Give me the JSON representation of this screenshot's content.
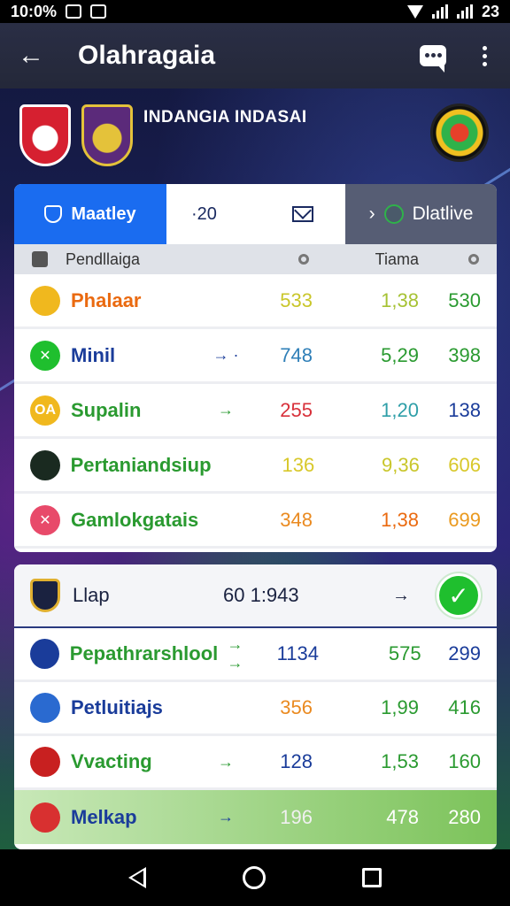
{
  "status_bar": {
    "time": "10:0%",
    "battery": "23"
  },
  "app_bar": {
    "title": "Olahragaia",
    "back_icon": "back-arrow-icon",
    "chat_icon": "chat-icon",
    "menu_icon": "more-vert-icon"
  },
  "league": {
    "name": "INDANGIA INDASAI"
  },
  "tabs": {
    "main": {
      "label": "Maatley",
      "icon": "shield-icon"
    },
    "mid": {
      "label": "·20",
      "icon": "mail-icon"
    },
    "right": {
      "prefix": "›",
      "label": "Dlatlive",
      "icon": "globe-icon"
    }
  },
  "table_header": {
    "team": "Pendllaiga",
    "total": "Tiama"
  },
  "rows": [
    {
      "name": "Phalaar",
      "arrow": "",
      "v1": "533",
      "v2": "1,38",
      "v3": "530",
      "icon_text": "",
      "colors": {
        "icon": "#f0b81e",
        "name": "#ea6a10",
        "v1": "#c9c62a",
        "v2": "#a6c234",
        "v3": "#2a9a30"
      }
    },
    {
      "name": "Minil",
      "arrow": "→ ·",
      "v1": "748",
      "v2": "5,29",
      "v3": "398",
      "icon_text": "✕",
      "colors": {
        "icon": "#1fbf2e",
        "name": "#1a3c9a",
        "v1": "#2f7fb8",
        "v2": "#2a9a30",
        "v3": "#2a9a30"
      }
    },
    {
      "name": "Supalin",
      "arrow": "→",
      "v1": "255",
      "v2": "1,20",
      "v3": "138",
      "icon_text": "OA",
      "colors": {
        "icon": "#f0b81e",
        "name": "#2a9a30",
        "v1": "#d8303a",
        "v2": "#2f9fa8",
        "v3": "#1a3c9a"
      }
    },
    {
      "name": "Pertaniandsiup",
      "arrow": "",
      "v1": "136",
      "v2": "9,36",
      "v3": "606",
      "icon_text": "",
      "colors": {
        "icon": "#1a2a20",
        "name": "#2a9a30",
        "v1": "#d8c82a",
        "v2": "#c9c62a",
        "v3": "#d8c82a"
      }
    },
    {
      "name": "Gamlokgatais",
      "arrow": "",
      "v1": "348",
      "v2": "1,38",
      "v3": "699",
      "icon_text": "✕",
      "colors": {
        "icon": "#e84a6a",
        "name": "#2a9a30",
        "v1": "#ea8a20",
        "v2": "#ea6a10",
        "v3": "#ea9a20"
      }
    }
  ],
  "card2": {
    "header": {
      "name": "Llap",
      "score": "60 1:943",
      "arrow": "→",
      "ok_icon": "check-circle-icon"
    },
    "rows": [
      {
        "name": "Pepathrarshlool",
        "arrow": "→  →",
        "v1": "1134",
        "v2": "575",
        "v3": "299",
        "colors": {
          "icon": "#1a3c9a",
          "name": "#2a9a30",
          "v1": "#1a3c9a",
          "v2": "#2a9a30",
          "v3": "#1a3c9a"
        }
      },
      {
        "name": "Petluitiajs",
        "arrow": "",
        "v1": "356",
        "v2": "1,99",
        "v3": "416",
        "colors": {
          "icon": "#2a6ad0",
          "name": "#1a3c9a",
          "v1": "#ea8a20",
          "v2": "#2a9a30",
          "v3": "#2a9a30"
        }
      },
      {
        "name": "Vvacting",
        "arrow": "→",
        "v1": "128",
        "v2": "1,53",
        "v3": "160",
        "colors": {
          "icon": "#c82020",
          "name": "#2a9a30",
          "v1": "#1a3c9a",
          "v2": "#2a9a30",
          "v3": "#2a9a30"
        }
      },
      {
        "name": "Melkap",
        "arrow": "→",
        "v1": "196",
        "v2": "478",
        "v3": "280",
        "colors": {
          "icon": "#d83030",
          "name": "#1a3c9a",
          "v1": "#f0f0f0",
          "v2": "#ffffff",
          "v3": "#ffffff"
        }
      }
    ]
  },
  "colors": {
    "accent": "#1a6cf0",
    "appbar": "#2a2e45",
    "ok": "#1fbf2e"
  }
}
